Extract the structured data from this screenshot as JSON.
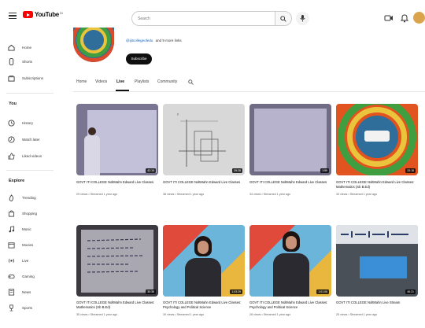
{
  "header": {
    "logo_text": "YouTube",
    "logo_region": "IN",
    "search_placeholder": "Search"
  },
  "sidebar": {
    "main": [
      "Home",
      "Shorts",
      "Subscriptions"
    ],
    "you_heading": "You",
    "you_items": [
      "History",
      "Watch later",
      "Liked videos"
    ],
    "explore_heading": "Explore",
    "explore_items": [
      "Trending",
      "Shopping",
      "Music",
      "Movies",
      "Live",
      "Gaming",
      "News",
      "Sports"
    ]
  },
  "channel": {
    "handle": "@ijitcollegeofedu",
    "more_text": "and 9 more links",
    "subscribe_label": "Subscribe"
  },
  "tabs": [
    "Home",
    "Videos",
    "Live",
    "Playlists",
    "Community"
  ],
  "videos": [
    {
      "title": "GOVT ITI COLLEGE NoltMahn Edward Live Classes",
      "meta": "29 views • Streamed 1 year ago",
      "duration": "42:19"
    },
    {
      "title": "GOVT ITI COLLEGE NoltMahn Edward Live Classes",
      "meta": "38 views • Streamed 1 year ago",
      "duration": "39:28"
    },
    {
      "title": "GOVT ITI COLLEGE NoltMahn Edward Live Classes",
      "meta": "34 views • Streamed 1 year ago",
      "duration": "1:59"
    },
    {
      "title": "GOVT ITI COLLEGE NoltMahn Edward Live Classes: Mathematics (Sb B.Ed)",
      "meta": "33 views • Streamed 1 year ago",
      "duration": "33:18"
    },
    {
      "title": "GOVT ITI COLLEGE NoltMahn Edward Live Classes: Mathematics (Sb B.Ed)",
      "meta": "35 views • Streamed 1 year ago",
      "duration": "30:38"
    },
    {
      "title": "GOVT ITI COLLEGE NoltMahn Edward Live Classes: Psychology and Political Science",
      "meta": "30 views • Streamed 1 year ago",
      "duration": "1:03:29"
    },
    {
      "title": "GOVT ITI COLLEGE NoltMahn Edward Live Classes: Psychology and Political Science",
      "meta": "28 views • Streamed 1 year ago",
      "duration": "1:01:06"
    },
    {
      "title": "GOVT ITI COLLEGE NoltMahn Live Stream",
      "meta": "25 views • Streamed 1 year ago",
      "duration": "46:21"
    }
  ],
  "colors": {
    "brand_red": "#ff0000",
    "link_blue": "#1565c0",
    "subscribe_black": "#0f0f0f"
  },
  "icons": [
    "menu-icon",
    "search-icon",
    "mic-icon",
    "create-icon",
    "bell-icon",
    "home-icon",
    "shorts-icon",
    "subscriptions-icon",
    "history-icon",
    "watch-later-icon",
    "liked-icon",
    "trending-icon",
    "shopping-icon",
    "music-icon",
    "movies-icon",
    "live-icon",
    "gaming-icon",
    "news-icon",
    "sports-icon"
  ]
}
